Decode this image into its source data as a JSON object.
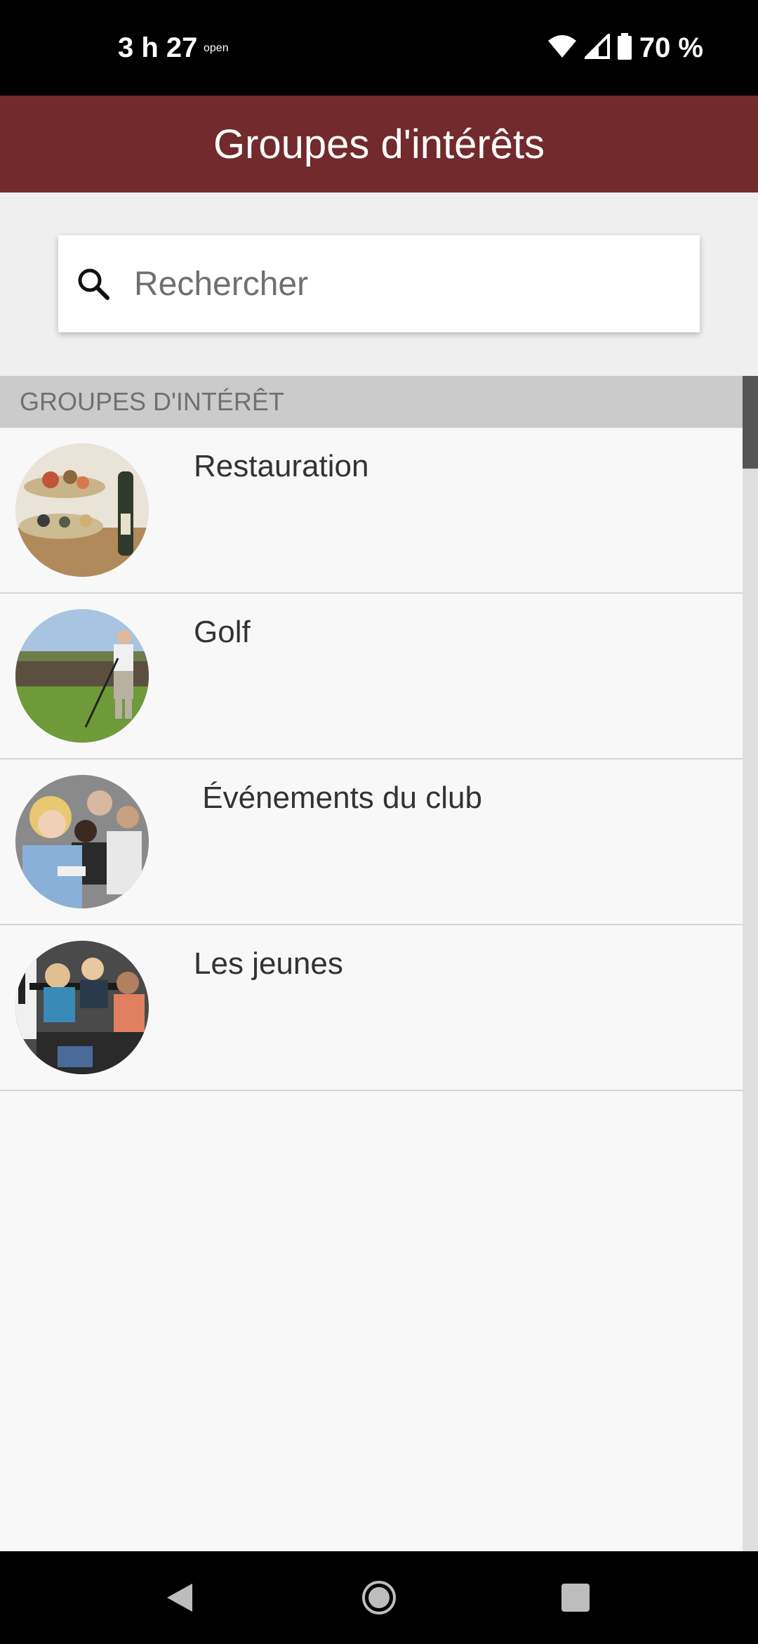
{
  "status_bar": {
    "time": "3 h 27",
    "open_label": "open",
    "battery": "70 %"
  },
  "app_bar": {
    "title": "Groupes d'intérêts"
  },
  "search": {
    "placeholder": "Rechercher",
    "value": ""
  },
  "section": {
    "header": "GROUPES D'INTÉRÊT"
  },
  "groups": [
    {
      "name": "Restauration",
      "image": "food-platter-image"
    },
    {
      "name": "Golf",
      "image": "golfer-image"
    },
    {
      "name": " Événements du club",
      "image": "club-event-image"
    },
    {
      "name": "Les jeunes",
      "image": "youth-group-image"
    }
  ],
  "icons": {
    "search": "search-icon",
    "wifi": "wifi-icon",
    "signal": "signal-icon",
    "battery": "battery-icon",
    "back": "back-icon",
    "home": "home-icon",
    "recents": "recents-icon"
  },
  "colors": {
    "app_bar": "#722a2c",
    "section_header": "#cbcbcb",
    "background": "#f8f8f8"
  }
}
